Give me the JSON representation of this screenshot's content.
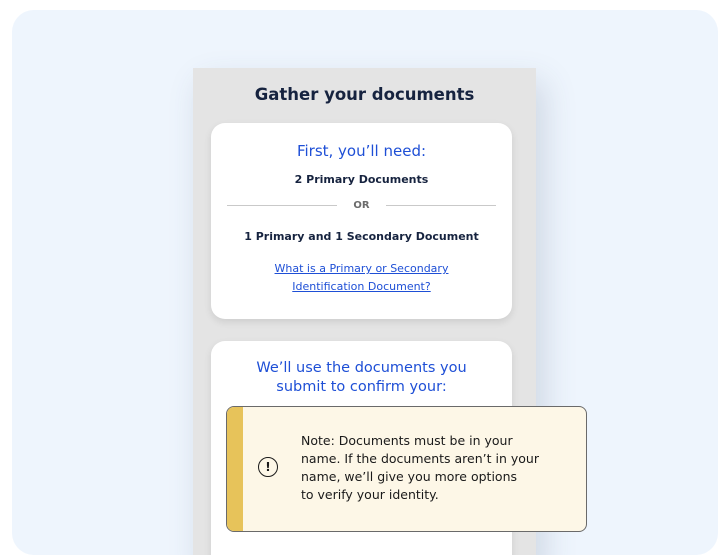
{
  "screen": {
    "title": "Gather your documents"
  },
  "requirements_card": {
    "heading": "First, you’ll need:",
    "option_one": "2 Primary Documents",
    "divider_text": "OR",
    "option_two": "1 Primary and 1 Secondary Document",
    "link_line_1": "What is a Primary or Secondary",
    "link_line_2": "Identification Document?"
  },
  "confirm_card": {
    "heading_line_1": "We’ll use the documents you",
    "heading_line_2": "submit to confirm your:"
  },
  "note": {
    "icon": "exclamation-circle-icon",
    "lines": [
      "Note: Documents must be in your",
      "name. If the documents aren’t in your",
      "name, we’ll give you more options",
      "to verify your identity."
    ]
  },
  "colors": {
    "accent_blue": "#1e4fd6",
    "dark_text": "#16233f",
    "note_stripe": "#e7c35a",
    "note_background": "#fdf7e7",
    "backdrop": "#eef5fd"
  }
}
